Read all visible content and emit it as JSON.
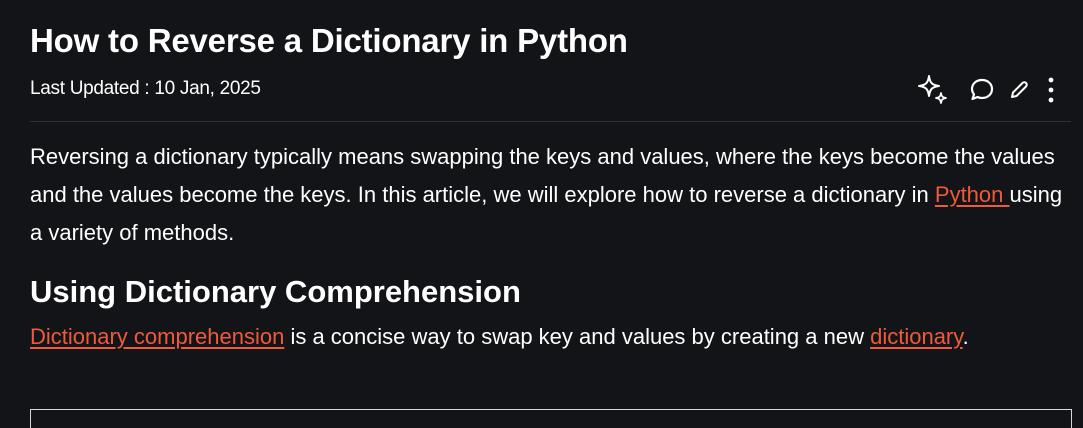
{
  "article": {
    "title": "How to Reverse a Dictionary in Python",
    "last_updated": "Last Updated : 10 Jan, 2025",
    "intro_before_link": "Reversing a dictionary typically means swapping the keys and values, where the keys become the values and the values become the keys. In this article, we will explore how to reverse a dictionary in ",
    "intro_link": "Python ",
    "intro_after_link": "using a variety of methods.",
    "section_heading": "Using Dictionary Comprehension",
    "section_link_1": "Dictionary comprehension",
    "section_text_mid": " is a concise way to swap key and values by creating a new ",
    "section_link_2": "dictionary",
    "section_text_end": "."
  },
  "toolbar": {
    "icons": [
      "ai-sparkle-icon",
      "comment-icon",
      "edit-pencil-icon",
      "more-vertical-icon"
    ]
  },
  "colors": {
    "background": "#131417",
    "text": "#ffffff",
    "link": "#ef5a3a",
    "divider": "#2f3136"
  }
}
